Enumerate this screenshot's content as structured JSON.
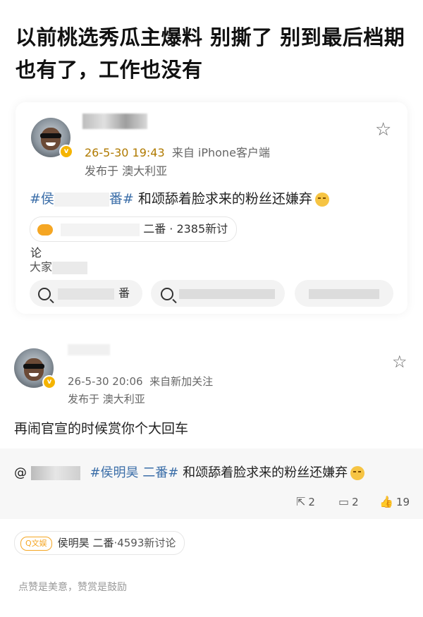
{
  "headline": "以前桃选秀瓜主爆料 别撕了 别到最后档期也有了，工作也没有",
  "card1": {
    "time": "26-5-30 19:43",
    "source": "来自 iPhone客户端",
    "location": "发布于 澳大利亚",
    "topic_prefix": "#侯",
    "topic_suffix": "番#",
    "body_text": "和颂舔着脸求来的粉丝还嫌弃",
    "pill_text": "二番 · 2385新讨论",
    "recommend_prefix": "大家",
    "rec_pill1_text": "番",
    "star_icon": "star-icon"
  },
  "post2": {
    "time": "26-5-30 20:06",
    "source": "来自新加关注",
    "location": "发布于 澳大利亚",
    "body": "再闹官宣的时候赏你个大回车",
    "quote_at": "@",
    "quote_topic": "#侯明昊 二番#",
    "quote_text": "和颂舔着脸求来的粉丝还嫌弃",
    "repost_count": "2",
    "comment_count": "2",
    "like_count": "19"
  },
  "footer": {
    "tag_label": "Q文娱",
    "topic": "侯明昊 二番",
    "discussions": "·4593新讨论",
    "note": "点赞是美意，赞赏是鼓励"
  },
  "colors": {
    "accent_blue": "#3b6ea8",
    "vip_orange": "#f5a623",
    "time_gold": "#b07a00"
  }
}
